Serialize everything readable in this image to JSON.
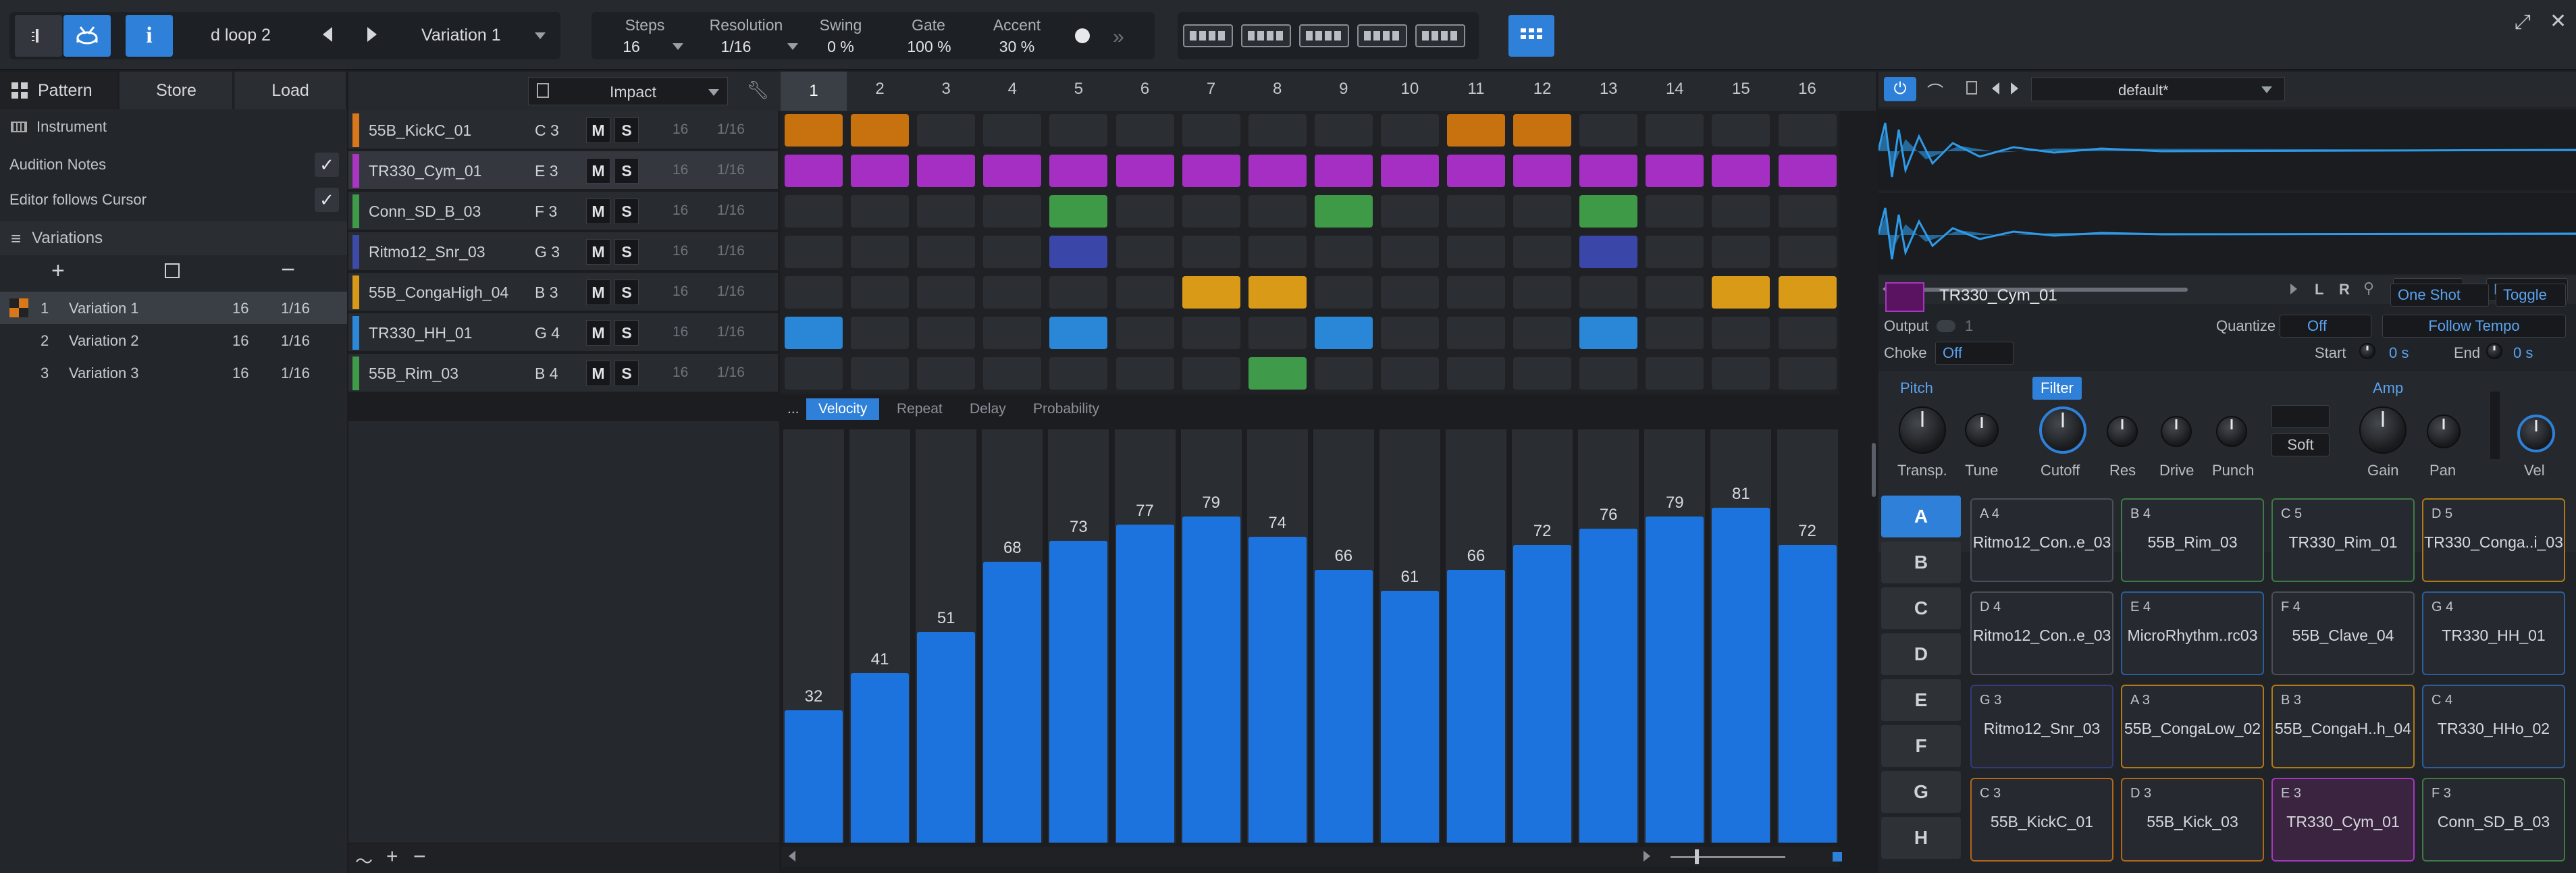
{
  "topbar": {
    "loop_name": "d loop 2",
    "variation": "Variation 1",
    "info_label": "i",
    "params": [
      {
        "label": "Steps",
        "value": "16"
      },
      {
        "label": "Resolution",
        "value": "1/16"
      },
      {
        "label": "Swing",
        "value": "0 %"
      },
      {
        "label": "Gate",
        "value": "100 %"
      },
      {
        "label": "Accent",
        "value": "30 %"
      }
    ]
  },
  "left": {
    "tabs": [
      "Pattern",
      "Store",
      "Load"
    ],
    "instrument_label": "Instrument",
    "audition_notes": "Audition Notes",
    "editor_follows": "Editor follows Cursor",
    "variations_label": "Variations",
    "variations": [
      {
        "num": "1",
        "name": "Variation 1",
        "steps": "16",
        "res": "1/16"
      },
      {
        "num": "2",
        "name": "Variation 2",
        "steps": "16",
        "res": "1/16"
      },
      {
        "num": "3",
        "name": "Variation 3",
        "steps": "16",
        "res": "1/16"
      }
    ]
  },
  "grid": {
    "kit": "Impact",
    "steps": [
      "1",
      "2",
      "3",
      "4",
      "5",
      "6",
      "7",
      "8",
      "9",
      "10",
      "11",
      "12",
      "13",
      "14",
      "15",
      "16"
    ],
    "instruments": [
      {
        "name": "55B_KickC_01",
        "note": "C 3",
        "m": "M",
        "s": "S",
        "len": "16",
        "res": "1/16",
        "color": "#d8781a"
      },
      {
        "name": "TR330_Cym_01",
        "note": "E 3",
        "m": "M",
        "s": "S",
        "len": "16",
        "res": "1/16",
        "color": "#a836c0"
      },
      {
        "name": "Conn_SD_B_03",
        "note": "F 3",
        "m": "M",
        "s": "S",
        "len": "16",
        "res": "1/16",
        "color": "#3f9a4a"
      },
      {
        "name": "Ritmo12_Snr_03",
        "note": "G 3",
        "m": "M",
        "s": "S",
        "len": "16",
        "res": "1/16",
        "color": "#3d4aa8"
      },
      {
        "name": "55B_CongaHigh_04",
        "note": "B 3",
        "m": "M",
        "s": "S",
        "len": "16",
        "res": "1/16",
        "color": "#d79a18"
      },
      {
        "name": "TR330_HH_01",
        "note": "G 4",
        "m": "M",
        "s": "S",
        "len": "16",
        "res": "1/16",
        "color": "#2e88d8"
      },
      {
        "name": "55B_Rim_03",
        "note": "B 4",
        "m": "M",
        "s": "S",
        "len": "16",
        "res": "1/16",
        "color": "#3f9a4a"
      }
    ],
    "active_colors": [
      "#c8720f",
      "#a62fc3",
      "#3e9a47",
      "#3a46a8",
      "#d99a17",
      "#2a86d6",
      "#3f9a4a"
    ],
    "pattern": [
      [
        1,
        1,
        0,
        0,
        0,
        0,
        0,
        0,
        0,
        0,
        1,
        1,
        0,
        0,
        0,
        0
      ],
      [
        1,
        1,
        1,
        1,
        1,
        1,
        1,
        1,
        1,
        1,
        1,
        1,
        1,
        1,
        1,
        1
      ],
      [
        0,
        0,
        0,
        0,
        1,
        0,
        0,
        0,
        1,
        0,
        0,
        0,
        1,
        0,
        0,
        0
      ],
      [
        0,
        0,
        0,
        0,
        1,
        0,
        0,
        0,
        0,
        0,
        0,
        0,
        1,
        0,
        0,
        0
      ],
      [
        0,
        0,
        0,
        0,
        0,
        0,
        1,
        1,
        0,
        0,
        0,
        0,
        0,
        0,
        1,
        1
      ],
      [
        1,
        0,
        0,
        0,
        1,
        0,
        0,
        0,
        1,
        0,
        0,
        0,
        1,
        0,
        0,
        0
      ],
      [
        0,
        0,
        0,
        0,
        0,
        0,
        0,
        1,
        0,
        0,
        0,
        0,
        0,
        0,
        0,
        0
      ]
    ]
  },
  "velocity": {
    "tabs": [
      "...",
      "Velocity",
      "Repeat",
      "Delay",
      "Probability"
    ],
    "values": [
      32,
      41,
      51,
      68,
      73,
      77,
      79,
      74,
      66,
      61,
      66,
      72,
      76,
      79,
      81,
      72
    ]
  },
  "right": {
    "preset": "default*",
    "reverse": "Reverse",
    "normalize": "Normalize",
    "l_label": "L",
    "r_label": "R",
    "sample_name": "TR330_Cym_01",
    "one_shot": "One Shot",
    "toggle": "Toggle",
    "output_label": "Output",
    "output_value": "1",
    "quantize_label": "Quantize",
    "quantize_value": "Off",
    "follow_tempo": "Follow Tempo",
    "choke_label": "Choke",
    "choke_value": "Off",
    "start_label": "Start",
    "start_value": "0 s",
    "end_label": "End",
    "end_value": "0 s",
    "pitch_label": "Pitch",
    "filter_label": "Filter",
    "amp_label": "Amp",
    "soft_label": "Soft",
    "knobs": [
      "Transp.",
      "Tune",
      "Cutoff",
      "Res",
      "Drive",
      "Punch",
      "Gain",
      "Pan",
      "Vel"
    ],
    "banks": [
      "A",
      "B",
      "C",
      "D",
      "E",
      "F",
      "G",
      "H"
    ],
    "pads": [
      {
        "note": "A 4",
        "name": "Ritmo12_Con..e_03",
        "color": "#4a4f58"
      },
      {
        "note": "B 4",
        "name": "55B_Rim_03",
        "color": "#3f7a45"
      },
      {
        "note": "C 5",
        "name": "TR330_Rim_01",
        "color": "#3f7a45"
      },
      {
        "note": "D 5",
        "name": "TR330_Conga..i_03",
        "color": "#b07a18"
      },
      {
        "note": "D 4",
        "name": "Ritmo12_Con..e_03",
        "color": "#4a4f58"
      },
      {
        "note": "E 4",
        "name": "MicroRhythm..rc03",
        "color": "#2c5e99"
      },
      {
        "note": "F 4",
        "name": "55B_Clave_04",
        "color": "#4a4f58"
      },
      {
        "note": "G 4",
        "name": "TR330_HH_01",
        "color": "#2c5e99"
      },
      {
        "note": "G 3",
        "name": "Ritmo12_Snr_03",
        "color": "#343a7a"
      },
      {
        "note": "A 3",
        "name": "55B_CongaLow_02",
        "color": "#b07a18"
      },
      {
        "note": "B 3",
        "name": "55B_CongaH..h_04",
        "color": "#b07a18"
      },
      {
        "note": "C 4",
        "name": "TR330_HHo_02",
        "color": "#2c5e99"
      },
      {
        "note": "C 3",
        "name": "55B_KickC_01",
        "color": "#b2661a"
      },
      {
        "note": "D 3",
        "name": "55B_Kick_03",
        "color": "#b2661a"
      },
      {
        "note": "E 3",
        "name": "TR330_Cym_01",
        "color": "#a836c0"
      },
      {
        "note": "F 3",
        "name": "Conn_SD_B_03",
        "color": "#3f7a45"
      }
    ]
  }
}
